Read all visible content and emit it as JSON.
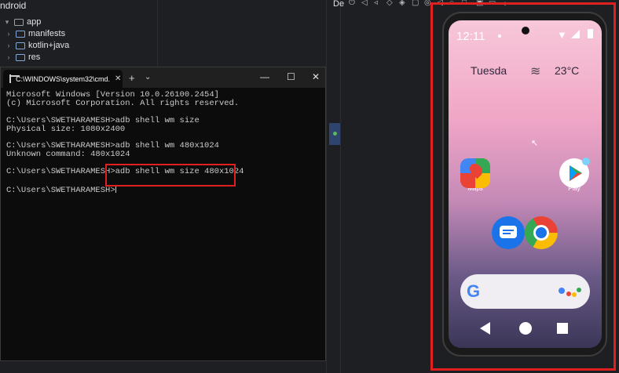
{
  "ide": {
    "title": "ndroid",
    "tree": [
      {
        "label": "app",
        "chevron": "▾"
      },
      {
        "label": "manifests",
        "chevron": "›"
      },
      {
        "label": "kotlin+java",
        "chevron": "›"
      },
      {
        "label": "res",
        "chevron": "›"
      }
    ],
    "emulator_title": "De"
  },
  "cmd": {
    "tab_title": "C:\\WINDOWS\\system32\\cmd.",
    "close": "✕",
    "new_tab": "+",
    "dropdown": "⌄",
    "minimize": "—",
    "maximize": "☐",
    "close_window": "✕",
    "lines": [
      "Microsoft Windows [Version 10.0.26100.2454]",
      "(c) Microsoft Corporation. All rights reserved.",
      "",
      "C:\\Users\\SWETHARAMESH>adb shell wm size",
      "Physical size: 1080x2400",
      "",
      "C:\\Users\\SWETHARAMESH>adb shell wm 480x1024",
      "Unknown command: 480x1024",
      "",
      "C:\\Users\\SWETHARAMESH>adb shell wm size 480x1024",
      "",
      "C:\\Users\\SWETHARAMESH>"
    ]
  },
  "phone": {
    "time": "12:11",
    "day": "Tuesda",
    "weather_icon": "fog-icon",
    "temperature": "23°C",
    "apps": [
      {
        "label": "Maps"
      },
      {
        "label": "Play"
      },
      {
        "label": ""
      },
      {
        "label": ""
      }
    ],
    "search_logo": "G"
  },
  "colors": {
    "highlight": "#e02020",
    "terminal_bg": "#0c0c0c",
    "ide_bg": "#1e1f22"
  }
}
